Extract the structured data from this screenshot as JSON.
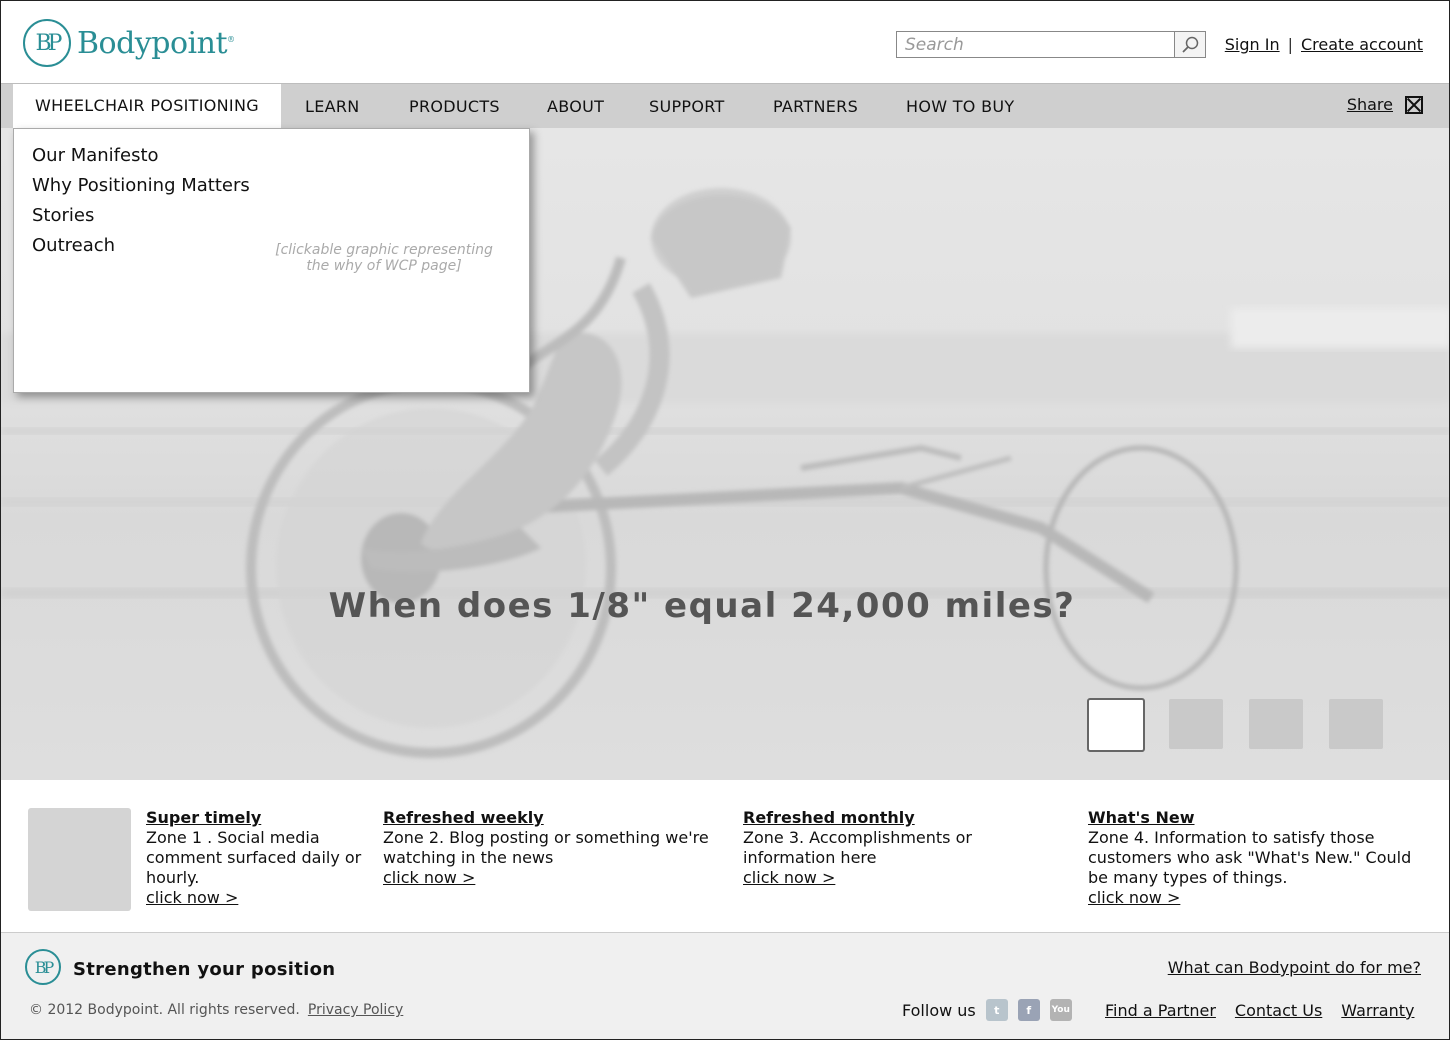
{
  "brand": {
    "logo_mark": "BP",
    "name": "Bodypoint",
    "registered": "®",
    "accent_color": "#2a8e95"
  },
  "search": {
    "placeholder": "Search",
    "icon": "search-icon"
  },
  "account": {
    "sign_in": "Sign In",
    "separator": "|",
    "create_account": "Create account"
  },
  "nav": {
    "items": [
      "WHEELCHAIR POSITIONING",
      "LEARN",
      "PRODUCTS",
      "ABOUT",
      "SUPPORT",
      "PARTNERS",
      "HOW TO BUY"
    ],
    "active": "WHEELCHAIR POSITIONING",
    "share": "Share"
  },
  "dropdown": {
    "items": [
      "Our Manifesto",
      "Why Positioning Matters",
      "Stories",
      "Outreach"
    ],
    "note": "[clickable graphic representing the why of WCP page]"
  },
  "hero": {
    "headline": "When does 1/8\" equal 24,000 miles?",
    "slides": 4,
    "active_slide": 1
  },
  "zones": [
    {
      "title": "Super timely",
      "body": "Zone 1 . Social media comment surfaced daily or hourly.",
      "link": "click now >"
    },
    {
      "title": "Refreshed weekly",
      "body": "Zone 2. Blog posting or something we're watching in the news",
      "link": "click now >"
    },
    {
      "title": "Refreshed monthly",
      "body": "Zone 3. Accomplishments or information here",
      "link": "click now >"
    },
    {
      "title": "What's New",
      "body": "Zone 4. Information to satisfy those customers who ask \"What's New.\" Could be many types of things.",
      "link": "click now >"
    }
  ],
  "footer": {
    "logo_mark": "BP",
    "tagline": "Strengthen your position",
    "copyright": "© 2012 Bodypoint.  All rights reserved.",
    "privacy": "Privacy Policy",
    "ask": "What can Bodypoint do for me?",
    "follow": "Follow us",
    "social": [
      "twitter-icon",
      "facebook-icon",
      "youtube-icon"
    ],
    "links": [
      "Find a Partner",
      "Contact Us",
      "Warranty"
    ]
  }
}
